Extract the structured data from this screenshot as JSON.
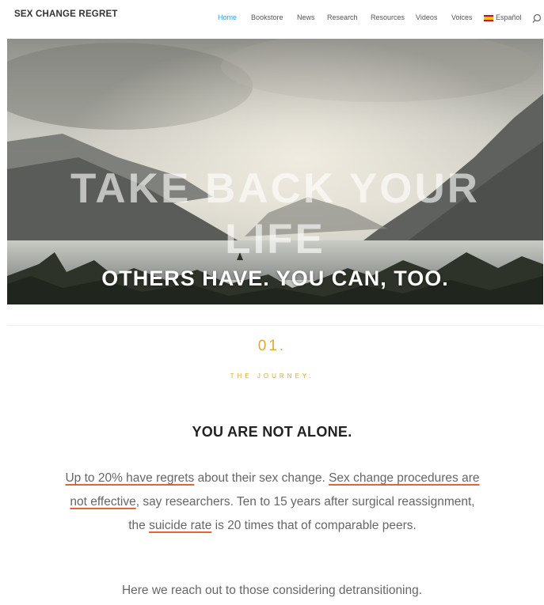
{
  "header": {
    "brand": "SEX CHANGE REGRET",
    "nav": [
      "Home",
      "Bookstore",
      "News",
      "Research",
      "Resources",
      "Videos",
      "Voices",
      "Español"
    ],
    "active_nav": "Home",
    "search_icon": "search-icon",
    "language_icon": "spain-flag-icon"
  },
  "hero": {
    "title_line1": "TAKE BACK YOUR",
    "title_line2": "LIFE",
    "subtitle": "OTHERS HAVE. YOU CAN, TOO."
  },
  "section": {
    "number": "01.",
    "label": "THE JOURNEY.",
    "heading": "YOU ARE NOT ALONE.",
    "p1": {
      "link1": "Up to 20% have regrets",
      "t1": " about their sex change. ",
      "link2": "Sex change procedures are not effective",
      "t2": ", say researchers. Ten to 15 years after surgical reassignment, the ",
      "link3": "suicide rate",
      "t3": " is 20 times that of comparable peers."
    },
    "p2": "Here we reach out to those considering detransitioning."
  },
  "colors": {
    "accent": "#2ea3f2",
    "gold": "#e5a82d",
    "link_underline": "#e2643c"
  }
}
